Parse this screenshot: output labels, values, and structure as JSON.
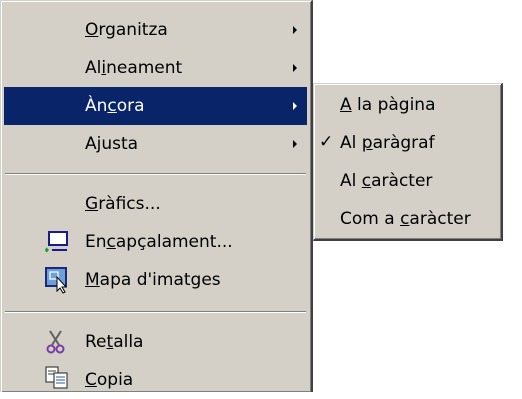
{
  "main_menu": {
    "items": [
      {
        "pre": "",
        "key": "O",
        "post": "rganitza",
        "submenu": true
      },
      {
        "pre": "Al",
        "key": "i",
        "post": "neament",
        "submenu": true
      },
      {
        "pre": "Àn",
        "key": "c",
        "post": "ora",
        "submenu": true,
        "highlighted": true
      },
      {
        "pre": "A",
        "key": "j",
        "post": "usta",
        "submenu": true
      },
      {
        "pre": "",
        "key": "G",
        "post": "ràfics...",
        "icon": ""
      },
      {
        "pre": "En",
        "key": "c",
        "post": "apçalament...",
        "icon": "header-monitor-icon"
      },
      {
        "pre": "",
        "key": "M",
        "post": "apa d'imatges",
        "icon": "image-map-icon"
      },
      {
        "pre": "Re",
        "key": "t",
        "post": "alla",
        "icon": "scissors-icon"
      },
      {
        "pre": "",
        "key": "C",
        "post": "opia",
        "icon": "copy-icon"
      }
    ]
  },
  "anchor_submenu": {
    "items": [
      {
        "pre": "",
        "key": "A",
        "post": " la pàgina",
        "checked": false
      },
      {
        "pre": "Al ",
        "key": "p",
        "post": "aràgraf",
        "checked": true
      },
      {
        "pre": "Al ",
        "key": "c",
        "post": "aràcter",
        "checked": false
      },
      {
        "pre": "Com a ",
        "key": "c",
        "post": "aràcter",
        "checked": false
      }
    ],
    "check_glyph": "✓"
  },
  "colors": {
    "menu_bg": "#d4d0c8",
    "highlight_bg": "#0a246a",
    "highlight_text": "#ffffff"
  }
}
